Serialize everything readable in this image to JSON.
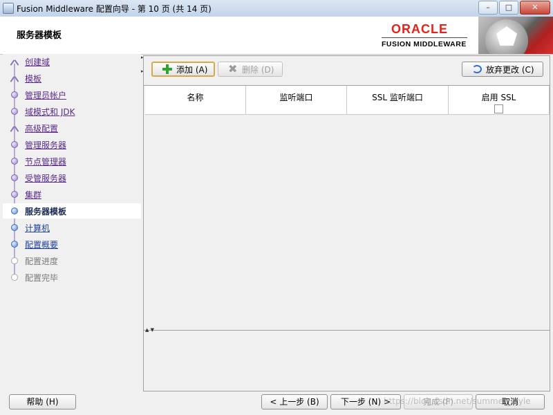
{
  "window": {
    "title": "Fusion Middleware 配置向导 - 第 10 页 (共 14 页)",
    "minimize": "–",
    "maximize": "□",
    "close": "✕"
  },
  "header": {
    "page_title": "服务器模板",
    "brand_oracle": "ORACLE",
    "brand_sub": "FUSION MIDDLEWARE"
  },
  "sidebar": {
    "items": [
      {
        "label": "创建域",
        "state": "done"
      },
      {
        "label": "模板",
        "state": "done"
      },
      {
        "label": "管理员帐户",
        "state": "done"
      },
      {
        "label": "域模式和 JDK",
        "state": "done"
      },
      {
        "label": "高级配置",
        "state": "done"
      },
      {
        "label": "管理服务器",
        "state": "done"
      },
      {
        "label": "节点管理器",
        "state": "done"
      },
      {
        "label": "受管服务器",
        "state": "done"
      },
      {
        "label": "集群",
        "state": "done"
      },
      {
        "label": "服务器模板",
        "state": "current"
      },
      {
        "label": "计算机",
        "state": "next"
      },
      {
        "label": "配置概要",
        "state": "next"
      },
      {
        "label": "配置进度",
        "state": "disabled"
      },
      {
        "label": "配置完毕",
        "state": "disabled"
      }
    ]
  },
  "toolbar": {
    "add_label": "添加 (A)",
    "delete_label": "删除 (D)",
    "discard_label": "放弃更改 (C)"
  },
  "table": {
    "columns": [
      "名称",
      "监听端口",
      "SSL 监听端口",
      "启用 SSL"
    ],
    "rows": []
  },
  "footer": {
    "help_label": "帮助 (H)",
    "back_label": "< 上一步 (B)",
    "next_label": "下一步 (N) >",
    "finish_label": "完成 (F)",
    "cancel_label": "取消",
    "watermark": "https://blog.csdn.net/summer_style"
  },
  "colors": {
    "oracle_red": "#e2231a",
    "nav_done": "#5a2b8a",
    "nav_next": "#1f3f9a"
  }
}
